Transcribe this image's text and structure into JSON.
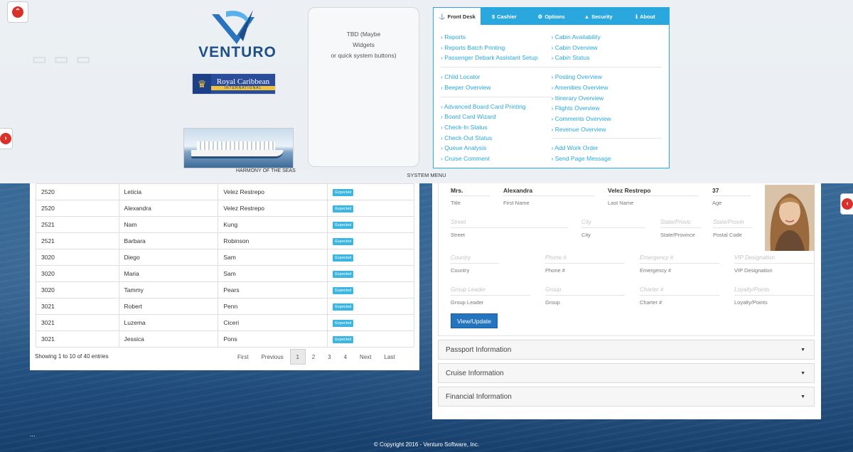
{
  "branding": {
    "logo_text": "VENTURO",
    "partner_name": "Royal Caribbean",
    "partner_sub": "INTERNATIONAL",
    "ship_caption": "HARMONY OF THE SEAS"
  },
  "placeholder_box": {
    "line1": "TBD (Maybe",
    "line2": "Widgets",
    "line3": "or quick system buttons)"
  },
  "system_menu": {
    "label": "SYSTEM MENU",
    "tabs": [
      {
        "label": "Front Desk",
        "icon": "anchor-icon",
        "glyph": "⚓"
      },
      {
        "label": "Cashier",
        "icon": "dollar-icon",
        "glyph": "$"
      },
      {
        "label": "Options",
        "icon": "gear-icon",
        "glyph": "⚙"
      },
      {
        "label": "Security",
        "icon": "warning-icon",
        "glyph": "▲"
      },
      {
        "label": "About",
        "icon": "info-icon",
        "glyph": "ℹ"
      }
    ],
    "left_groups": [
      [
        "› Reports",
        "› Reports Batch Printing",
        "› Passenger Debark Assistant Setup"
      ],
      [
        "› Child Locator",
        "› Beeper Overview"
      ],
      [
        "› Advanced Board Card Printing",
        "› Board Card Wizard",
        "› Check-In Status",
        "› Check-Out Status",
        "› Queue Analysis",
        "› Cruise Comment"
      ]
    ],
    "right_groups": [
      [
        "› Cabin Availability",
        "› Cabin Overview",
        "› Cabin Status"
      ],
      [
        "› Posting Overview",
        "› Amenities Overview",
        "› Itinerary Overview",
        "› Flights Overview",
        "› Comments Overview",
        "› Revenue Overview"
      ],
      [
        "› Add Work Order",
        "› Send Page Message"
      ]
    ]
  },
  "table": {
    "rows": [
      {
        "cabin": "2520",
        "first": "Leticia",
        "last": "Velez Restrepo",
        "status": "Expected"
      },
      {
        "cabin": "2520",
        "first": "Alexandra",
        "last": "Velez Restrepo",
        "status": "Expected"
      },
      {
        "cabin": "2521",
        "first": "Nam",
        "last": "Kung",
        "status": "Expected"
      },
      {
        "cabin": "2521",
        "first": "Barbara",
        "last": "Robinson",
        "status": "Expected"
      },
      {
        "cabin": "3020",
        "first": "Diego",
        "last": "Sam",
        "status": "Expected"
      },
      {
        "cabin": "3020",
        "first": "Maria",
        "last": "Sam",
        "status": "Expected"
      },
      {
        "cabin": "3020",
        "first": "Tammy",
        "last": "Pears",
        "status": "Expected"
      },
      {
        "cabin": "3021",
        "first": "Robert",
        "last": "Penn",
        "status": "Expected"
      },
      {
        "cabin": "3021",
        "first": "Luzema",
        "last": "Ciceri",
        "status": "Expected"
      },
      {
        "cabin": "3021",
        "first": "Jessica",
        "last": "Pons",
        "status": "Expected"
      }
    ],
    "showing": "Showing 1 to 10 of 40 entries",
    "pager": {
      "first": "First",
      "previous": "Previous",
      "pages": [
        "1",
        "2",
        "3",
        "4"
      ],
      "next": "Next",
      "last": "Last",
      "current": "1"
    }
  },
  "guest_form": {
    "title_value": "Mrs.",
    "first_value": "Alexandra",
    "last_value": "Velez Restrepo",
    "age_value": "37",
    "labels": {
      "title": "Title",
      "first": "First Name",
      "last": "Last Name",
      "age": "Age",
      "street": "Street",
      "city": "City",
      "state": "State/Province",
      "postal": "Postal Code",
      "country": "Country",
      "phone": "Phone #",
      "emergency": "Emergency #",
      "vip": "VIP Designation",
      "group_leader": "Group Leader",
      "group": "Group",
      "charter": "Charter #",
      "loyalty": "Loyalty/Points"
    },
    "placeholders": {
      "street": "Street",
      "city": "City",
      "state": "State/Provic",
      "postal": "State/Provin",
      "country": "Country",
      "phone": "Phone #",
      "emergency": "Emergency #",
      "vip": "VIP Designation",
      "group_leader": "Group Leader",
      "group": "Group",
      "charter": "Charter #",
      "loyalty": "Loyalty/Points"
    },
    "button": "View/Update"
  },
  "accordions": [
    "Passport Information",
    "Cruise Information",
    "Financial Information"
  ],
  "footer": "© Copyright 2016 - Venturo Software, Inc.",
  "ellipsis": "...",
  "colors": {
    "accent": "#2aa8de",
    "badge": "#3bb6e2",
    "button": "#2474c0",
    "alert": "#d9302a"
  }
}
